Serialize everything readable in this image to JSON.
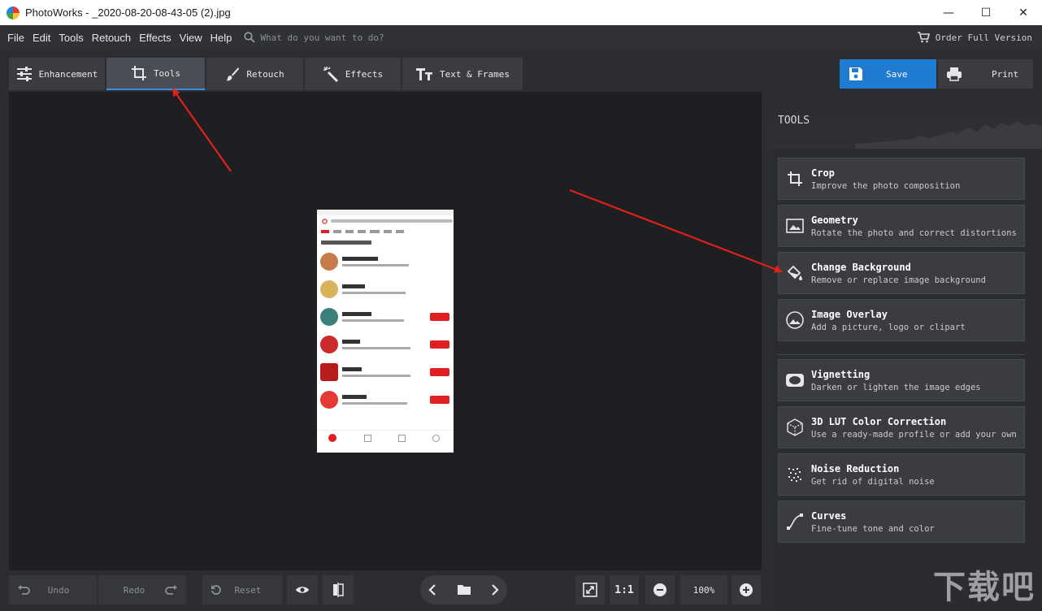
{
  "window": {
    "title": "PhotoWorks - _2020-08-20-08-43-05 (2).jpg",
    "controls": [
      "—",
      "☐",
      "✕"
    ]
  },
  "menu": {
    "items": [
      "File",
      "Edit",
      "Tools",
      "Retouch",
      "Effects",
      "View",
      "Help"
    ],
    "search_placeholder": "What do you want to do?",
    "order_label": "Order Full Version"
  },
  "tabs": [
    {
      "label": "Enhancement",
      "icon": "sliders-icon"
    },
    {
      "label": "Tools",
      "icon": "crop-icon",
      "active": true
    },
    {
      "label": "Retouch",
      "icon": "brush-icon"
    },
    {
      "label": "Effects",
      "icon": "magic-wand-icon"
    },
    {
      "label": "Text & Frames",
      "icon": "text-icon"
    }
  ],
  "actions": {
    "save_label": "Save",
    "print_label": "Print"
  },
  "panel": {
    "title": "TOOLS",
    "tools": [
      {
        "name": "Crop",
        "desc": "Improve the photo composition",
        "icon": "crop-icon"
      },
      {
        "name": "Geometry",
        "desc": "Rotate the photo and correct distortions",
        "icon": "geometry-icon"
      },
      {
        "name": "Change Background",
        "desc": "Remove or replace image background",
        "icon": "paint-bucket-icon"
      },
      {
        "name": "Image Overlay",
        "desc": "Add a picture, logo or clipart",
        "icon": "image-overlay-icon"
      },
      {
        "name": "Vignetting",
        "desc": "Darken or lighten the image edges",
        "icon": "vignette-icon"
      },
      {
        "name": "3D LUT Color Correction",
        "desc": "Use a ready-made profile or add your own",
        "icon": "cube-icon"
      },
      {
        "name": "Noise Reduction",
        "desc": "Get rid of digital noise",
        "icon": "noise-icon"
      },
      {
        "name": "Curves",
        "desc": "Fine-tune tone and color",
        "icon": "curves-icon"
      }
    ]
  },
  "bottom": {
    "undo_label": "Undo",
    "redo_label": "Redo",
    "reset_label": "Reset",
    "one_to_one": "1:1",
    "zoom_value": "100%"
  },
  "watermark": "下载吧",
  "colors": {
    "accent": "#1f7bd1",
    "arrow": "#e0201a",
    "follow_red": "#e02020"
  }
}
